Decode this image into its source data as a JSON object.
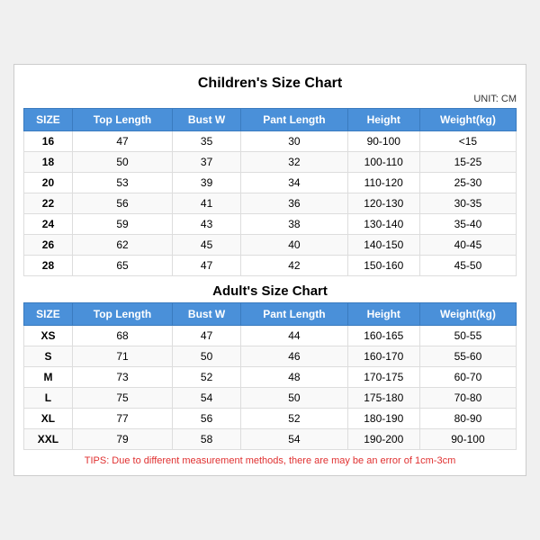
{
  "main_title": "Children's Size Chart",
  "unit": "UNIT: CM",
  "children_headers": [
    "SIZE",
    "Top Length",
    "Bust W",
    "Pant Length",
    "Height",
    "Weight(kg)"
  ],
  "children_rows": [
    [
      "16",
      "47",
      "35",
      "30",
      "90-100",
      "<15"
    ],
    [
      "18",
      "50",
      "37",
      "32",
      "100-110",
      "15-25"
    ],
    [
      "20",
      "53",
      "39",
      "34",
      "110-120",
      "25-30"
    ],
    [
      "22",
      "56",
      "41",
      "36",
      "120-130",
      "30-35"
    ],
    [
      "24",
      "59",
      "43",
      "38",
      "130-140",
      "35-40"
    ],
    [
      "26",
      "62",
      "45",
      "40",
      "140-150",
      "40-45"
    ],
    [
      "28",
      "65",
      "47",
      "42",
      "150-160",
      "45-50"
    ]
  ],
  "adult_title": "Adult's Size Chart",
  "adult_headers": [
    "SIZE",
    "Top Length",
    "Bust W",
    "Pant Length",
    "Height",
    "Weight(kg)"
  ],
  "adult_rows": [
    [
      "XS",
      "68",
      "47",
      "44",
      "160-165",
      "50-55"
    ],
    [
      "S",
      "71",
      "50",
      "46",
      "160-170",
      "55-60"
    ],
    [
      "M",
      "73",
      "52",
      "48",
      "170-175",
      "60-70"
    ],
    [
      "L",
      "75",
      "54",
      "50",
      "175-180",
      "70-80"
    ],
    [
      "XL",
      "77",
      "56",
      "52",
      "180-190",
      "80-90"
    ],
    [
      "XXL",
      "79",
      "58",
      "54",
      "190-200",
      "90-100"
    ]
  ],
  "tips": "TIPS: Due to different measurement methods, there are may be an error of 1cm-3cm"
}
